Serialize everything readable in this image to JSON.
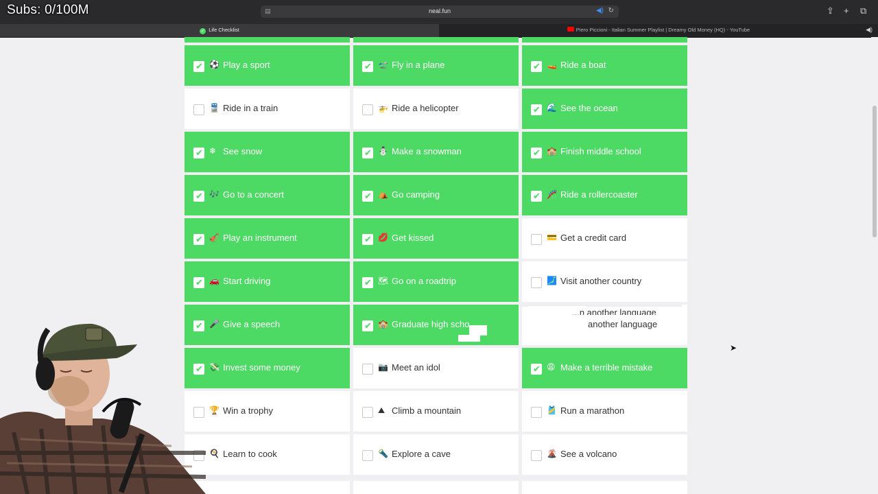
{
  "overlay": {
    "subs_text": "Subs: 0/100M"
  },
  "browser": {
    "url": "neal.fun",
    "tabs": [
      {
        "title": "Life Checklist",
        "active": true
      },
      {
        "title": "Piero Piccioni - Italian Summer Playlist | Dreamy Old Money (HQ) - YouTube",
        "active": false
      }
    ]
  },
  "colors": {
    "done": "#4cd964",
    "todo": "#ffffff",
    "chrome": "#2a2a2c"
  },
  "checklist": {
    "items": [
      {
        "emoji": "⚽",
        "label": "Play a sport",
        "checked": true
      },
      {
        "emoji": "🛫",
        "label": "Fly in a plane",
        "checked": true
      },
      {
        "emoji": "🚤",
        "label": "Ride a boat",
        "checked": true
      },
      {
        "emoji": "🚆",
        "label": "Ride in a train",
        "checked": false
      },
      {
        "emoji": "🚁",
        "label": "Ride a helicopter",
        "checked": false
      },
      {
        "emoji": "🌊",
        "label": "See the ocean",
        "checked": true
      },
      {
        "emoji": "❄",
        "label": "See snow",
        "checked": true
      },
      {
        "emoji": "⛄",
        "label": "Make a snowman",
        "checked": true
      },
      {
        "emoji": "🏫",
        "label": "Finish middle school",
        "checked": true
      },
      {
        "emoji": "🎶",
        "label": "Go to a concert",
        "checked": true
      },
      {
        "emoji": "⛺",
        "label": "Go camping",
        "checked": true
      },
      {
        "emoji": "🎢",
        "label": "Ride a rollercoaster",
        "checked": true
      },
      {
        "emoji": "🎻",
        "label": "Play an instrument",
        "checked": true
      },
      {
        "emoji": "💋",
        "label": "Get kissed",
        "checked": true
      },
      {
        "emoji": "💳",
        "label": "Get a credit card",
        "checked": false
      },
      {
        "emoji": "🚗",
        "label": "Start driving",
        "checked": true
      },
      {
        "emoji": "🗺",
        "label": "Go on a roadtrip",
        "checked": true
      },
      {
        "emoji": "🗾",
        "label": "Visit another country",
        "checked": false
      },
      {
        "emoji": "🎤",
        "label": "Give a speech",
        "checked": true
      },
      {
        "emoji": "🏫",
        "label": "Graduate high scho",
        "checked": true
      },
      {
        "emoji": "",
        "label": "another language",
        "checked": false
      },
      {
        "emoji": "💸",
        "label": "Invest some money",
        "checked": true
      },
      {
        "emoji": "📷",
        "label": "Meet an idol",
        "checked": false
      },
      {
        "emoji": "😩",
        "label": "Make a terrible mistake",
        "checked": true
      },
      {
        "emoji": "🏆",
        "label": "Win a trophy",
        "checked": false
      },
      {
        "emoji": "⛰",
        "label": "Climb a mountain",
        "checked": false
      },
      {
        "emoji": "🎽",
        "label": "Run a marathon",
        "checked": false
      },
      {
        "emoji": "🍳",
        "label": "Learn to cook",
        "checked": false
      },
      {
        "emoji": "🔦",
        "label": "Explore a cave",
        "checked": false
      },
      {
        "emoji": "🌋",
        "label": "See a volcano",
        "checked": false
      }
    ],
    "glitch_ghost_text": "...n another language"
  }
}
